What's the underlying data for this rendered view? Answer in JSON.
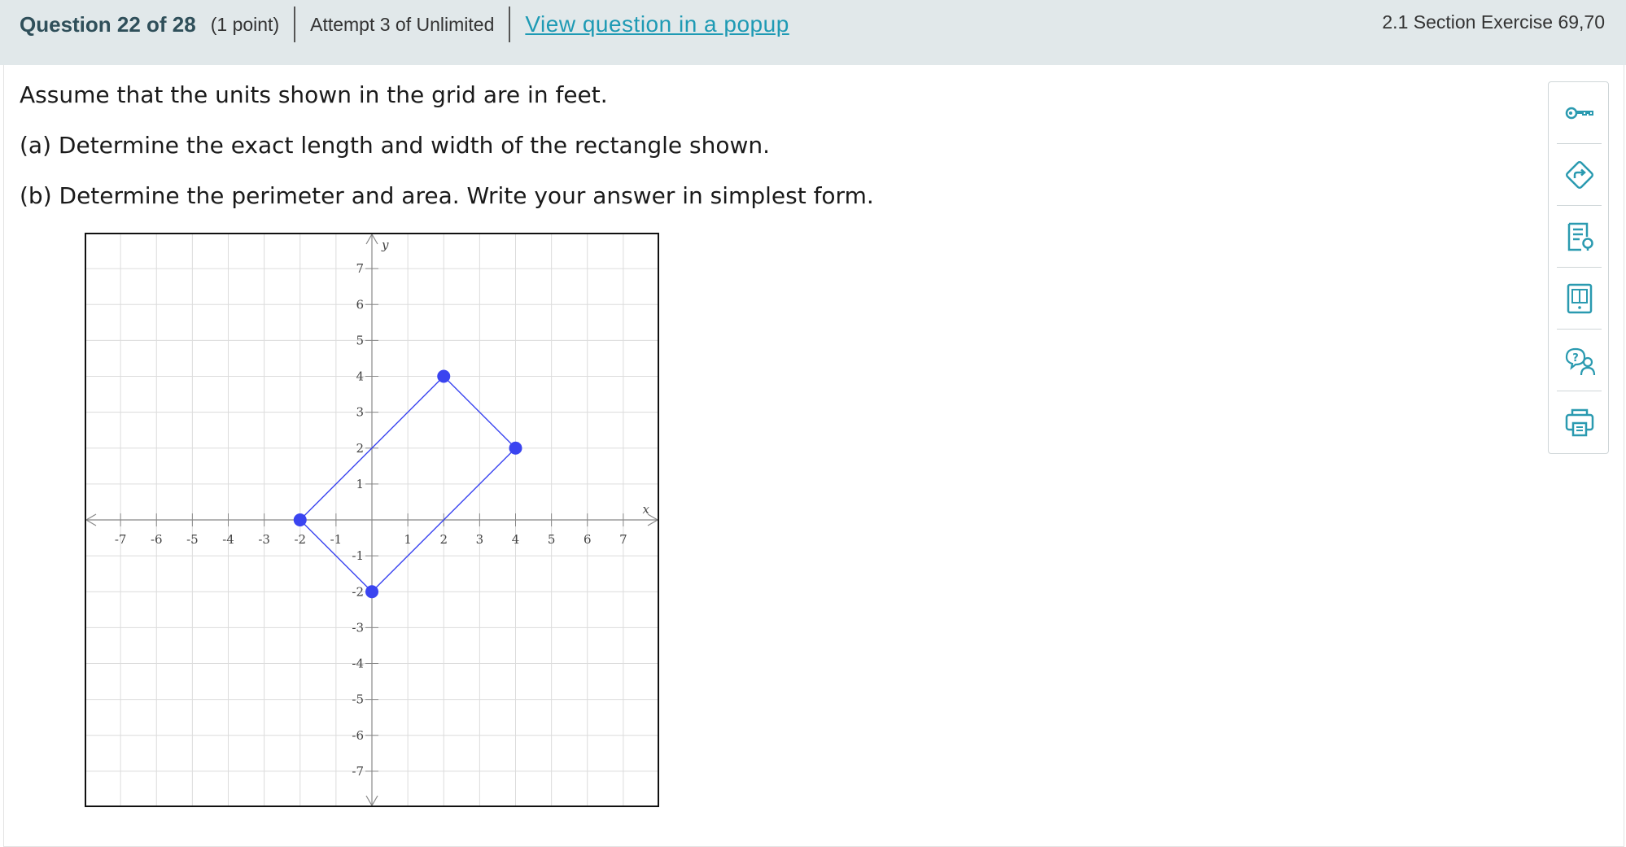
{
  "header": {
    "title": "Question 22 of 28",
    "points": "(1 point)",
    "attempt": "Attempt 3 of Unlimited",
    "popup_link": "View question in a popup",
    "section": "2.1 Section Exercise 69,70"
  },
  "problem": {
    "line1": "Assume that the units shown in the grid are in feet.",
    "line2": "(a) Determine the exact length and width of the rectangle shown.",
    "line3": "(b) Determine the perimeter and area. Write your answer in simplest form."
  },
  "toolbar": {
    "icons": [
      "key-icon",
      "direction-sign-icon",
      "document-hint-icon",
      "ebook-icon",
      "help-person-icon",
      "printer-icon"
    ]
  },
  "colors": {
    "header_bg": "#e1e8ea",
    "link": "#1e9ab4",
    "toolbar_icon": "#2a9ab0",
    "polygon": "#3a44f0"
  },
  "chart_data": {
    "type": "scatter",
    "xlabel": "x",
    "ylabel": "y",
    "xlim": [
      -8,
      8
    ],
    "ylim": [
      -8,
      8
    ],
    "grid": true,
    "x_ticks": [
      -7,
      -6,
      -5,
      -4,
      -3,
      -2,
      -1,
      1,
      2,
      3,
      4,
      5,
      6,
      7
    ],
    "y_ticks": [
      -7,
      -6,
      -5,
      -4,
      -3,
      -2,
      -1,
      1,
      2,
      3,
      4,
      5,
      6,
      7
    ],
    "points": [
      {
        "x": -2,
        "y": 0
      },
      {
        "x": 2,
        "y": 4
      },
      {
        "x": 4,
        "y": 2
      },
      {
        "x": 0,
        "y": -2
      }
    ],
    "polygon_closed": true
  }
}
